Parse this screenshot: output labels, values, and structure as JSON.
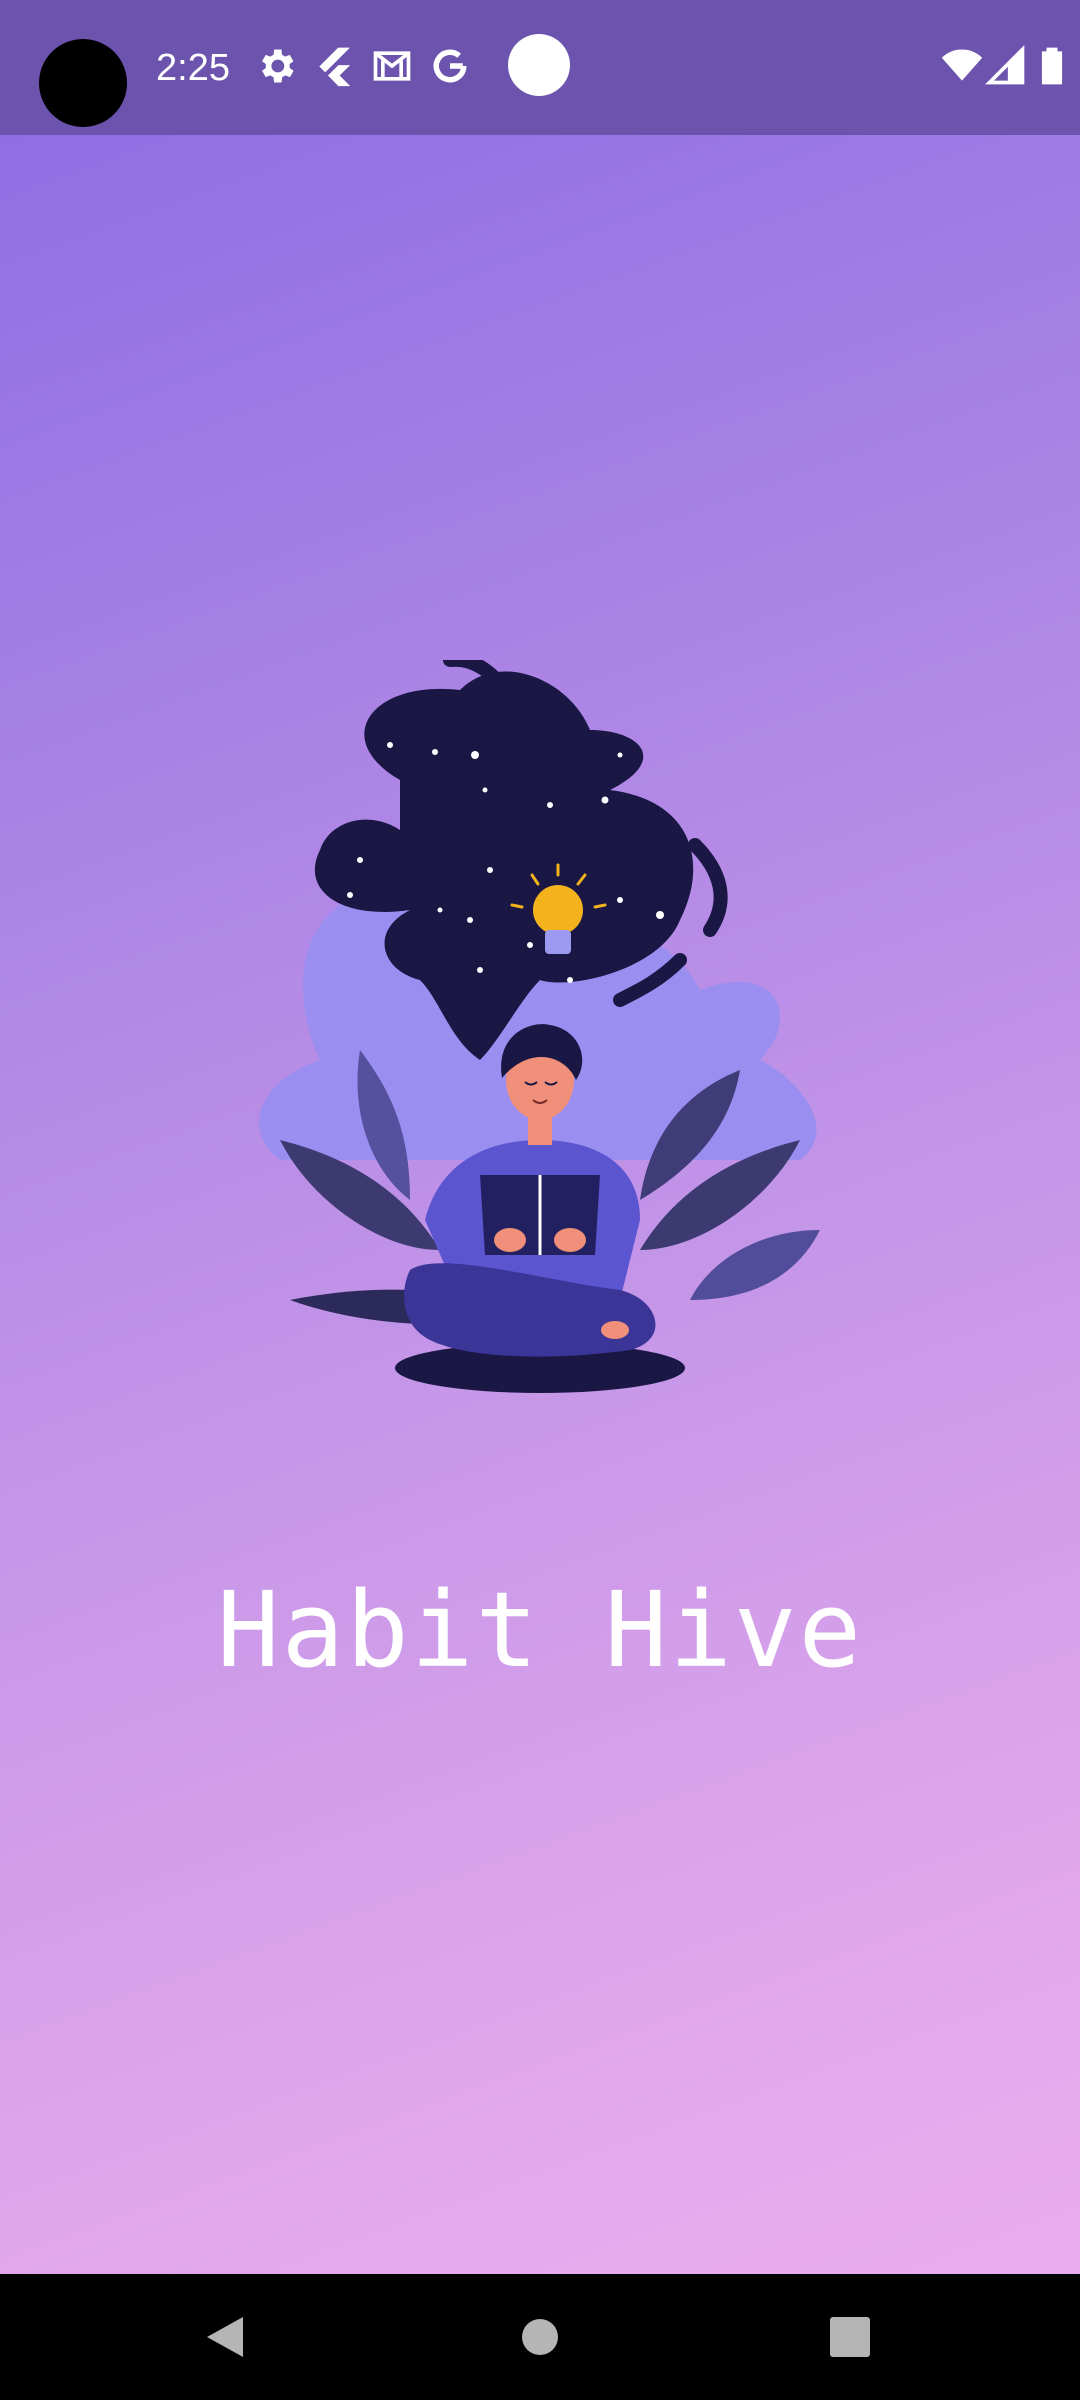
{
  "status_bar": {
    "time": "2:25",
    "left_icons": [
      "gear-icon",
      "flutter-icon",
      "gmail-icon",
      "google-icon"
    ],
    "right_icons": [
      "wifi-icon",
      "cell-signal-icon",
      "battery-icon"
    ]
  },
  "app": {
    "title": "Habit Hive"
  },
  "illustration": {
    "subject": "woman-reading-book-with-lightbulb-icon"
  },
  "nav_bar": {
    "buttons": [
      "back-icon",
      "home-icon",
      "recents-icon"
    ]
  },
  "colors": {
    "status_bar": "#6c53ad",
    "gradient_top": "#8a6be3",
    "gradient_bottom": "#eeaeee",
    "nav_bar": "#000000",
    "title_text": "#ffffff"
  }
}
